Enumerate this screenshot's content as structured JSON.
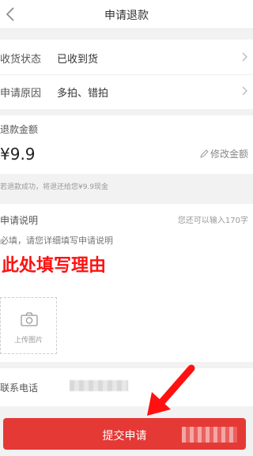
{
  "header": {
    "title": "申请退款"
  },
  "shipping": {
    "label": "收货状态",
    "value": "已收到货"
  },
  "reason": {
    "label": "申请原因",
    "value": "多拍、错拍"
  },
  "refund": {
    "label": "退款金额",
    "amount": "¥9.9",
    "edit_label": "修改金额",
    "note": "若退款成功，将退还给您¥9.9现金"
  },
  "description": {
    "label": "申请说明",
    "counter": "您还可以输入170字",
    "placeholder": "必填，请您详细填写申请说明"
  },
  "overlay_text": "此处填写理由",
  "upload": {
    "label": "上传图片"
  },
  "contact": {
    "label": "联系电话"
  },
  "submit": {
    "label": "提交申请"
  },
  "colors": {
    "accent": "#e53935",
    "overlay": "#ff1111"
  },
  "icons": [
    "back-icon",
    "chevron-right-icon",
    "pencil-icon",
    "camera-icon",
    "red-arrow-icon"
  ]
}
